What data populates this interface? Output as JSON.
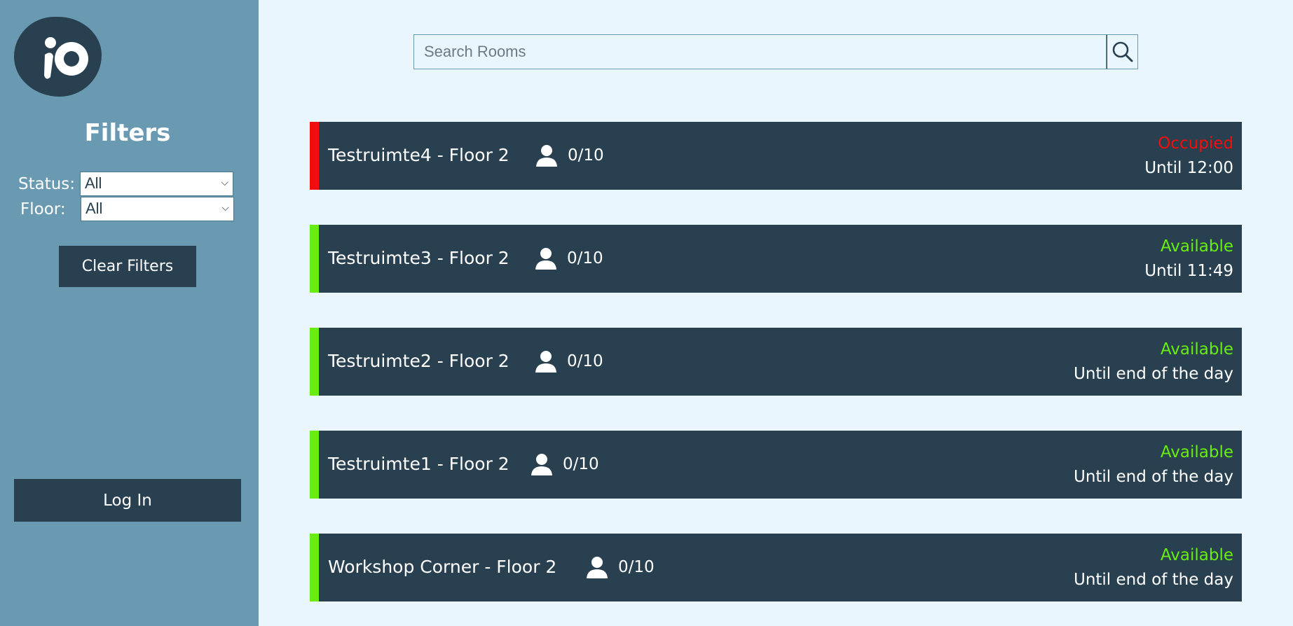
{
  "sidebar": {
    "logo_icon": "io-logo-icon",
    "filters_title": "Filters",
    "status_label": "Status:",
    "status_value": "All",
    "floor_label": "Floor:",
    "floor_value": "All",
    "clear_filters_label": "Clear Filters",
    "login_label": "Log In"
  },
  "search": {
    "placeholder": "Search Rooms",
    "value": "",
    "icon": "search-icon"
  },
  "colors": {
    "occupied": "#f40d0d",
    "available": "#68ed10",
    "card_bg": "#28404f",
    "sidebar_bg": "#6a9ab2",
    "page_bg": "#eaf6fd"
  },
  "rooms": [
    {
      "name": "Testruimte4 - Floor 2",
      "occupancy": "0/10",
      "status": "Occupied",
      "until": "Until 12:00"
    },
    {
      "name": "Testruimte3 - Floor 2",
      "occupancy": "0/10",
      "status": "Available",
      "until": "Until 11:49"
    },
    {
      "name": "Testruimte2 - Floor 2",
      "occupancy": "0/10",
      "status": "Available",
      "until": "Until end of the day"
    },
    {
      "name": "Testruimte1 - Floor 2",
      "occupancy": "0/10",
      "status": "Available",
      "until": "Until end of the day"
    },
    {
      "name": "Workshop Corner - Floor 2",
      "occupancy": "0/10",
      "status": "Available",
      "until": "Until end of the day"
    }
  ]
}
